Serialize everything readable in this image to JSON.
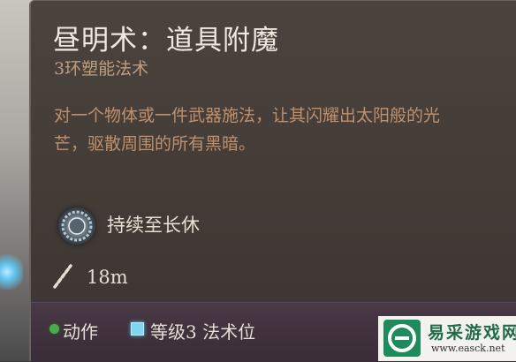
{
  "spell": {
    "title": "昼明术：道具附魔",
    "subtitle": "3环塑能法术",
    "description": "对一个物体或一件武器施法，让其闪耀出太阳般的光芒，驱散周围的所有黑暗。",
    "duration": {
      "icon": "duration-rune-icon",
      "label": "持续至长休"
    },
    "range": {
      "icon": "range-icon",
      "label": "18m"
    }
  },
  "footer": {
    "action": {
      "icon": "action-dot-icon",
      "label": "动作",
      "color": "#4caa4e"
    },
    "slot": {
      "icon": "spell-slot-icon",
      "label": "等级3 法术位",
      "color": "#7fd6ee"
    }
  },
  "watermark": {
    "name": "易采游戏网",
    "url": "www.easck.net",
    "logo_icon": "easck-logo-icon",
    "logo_color": "#1f8a5a"
  }
}
